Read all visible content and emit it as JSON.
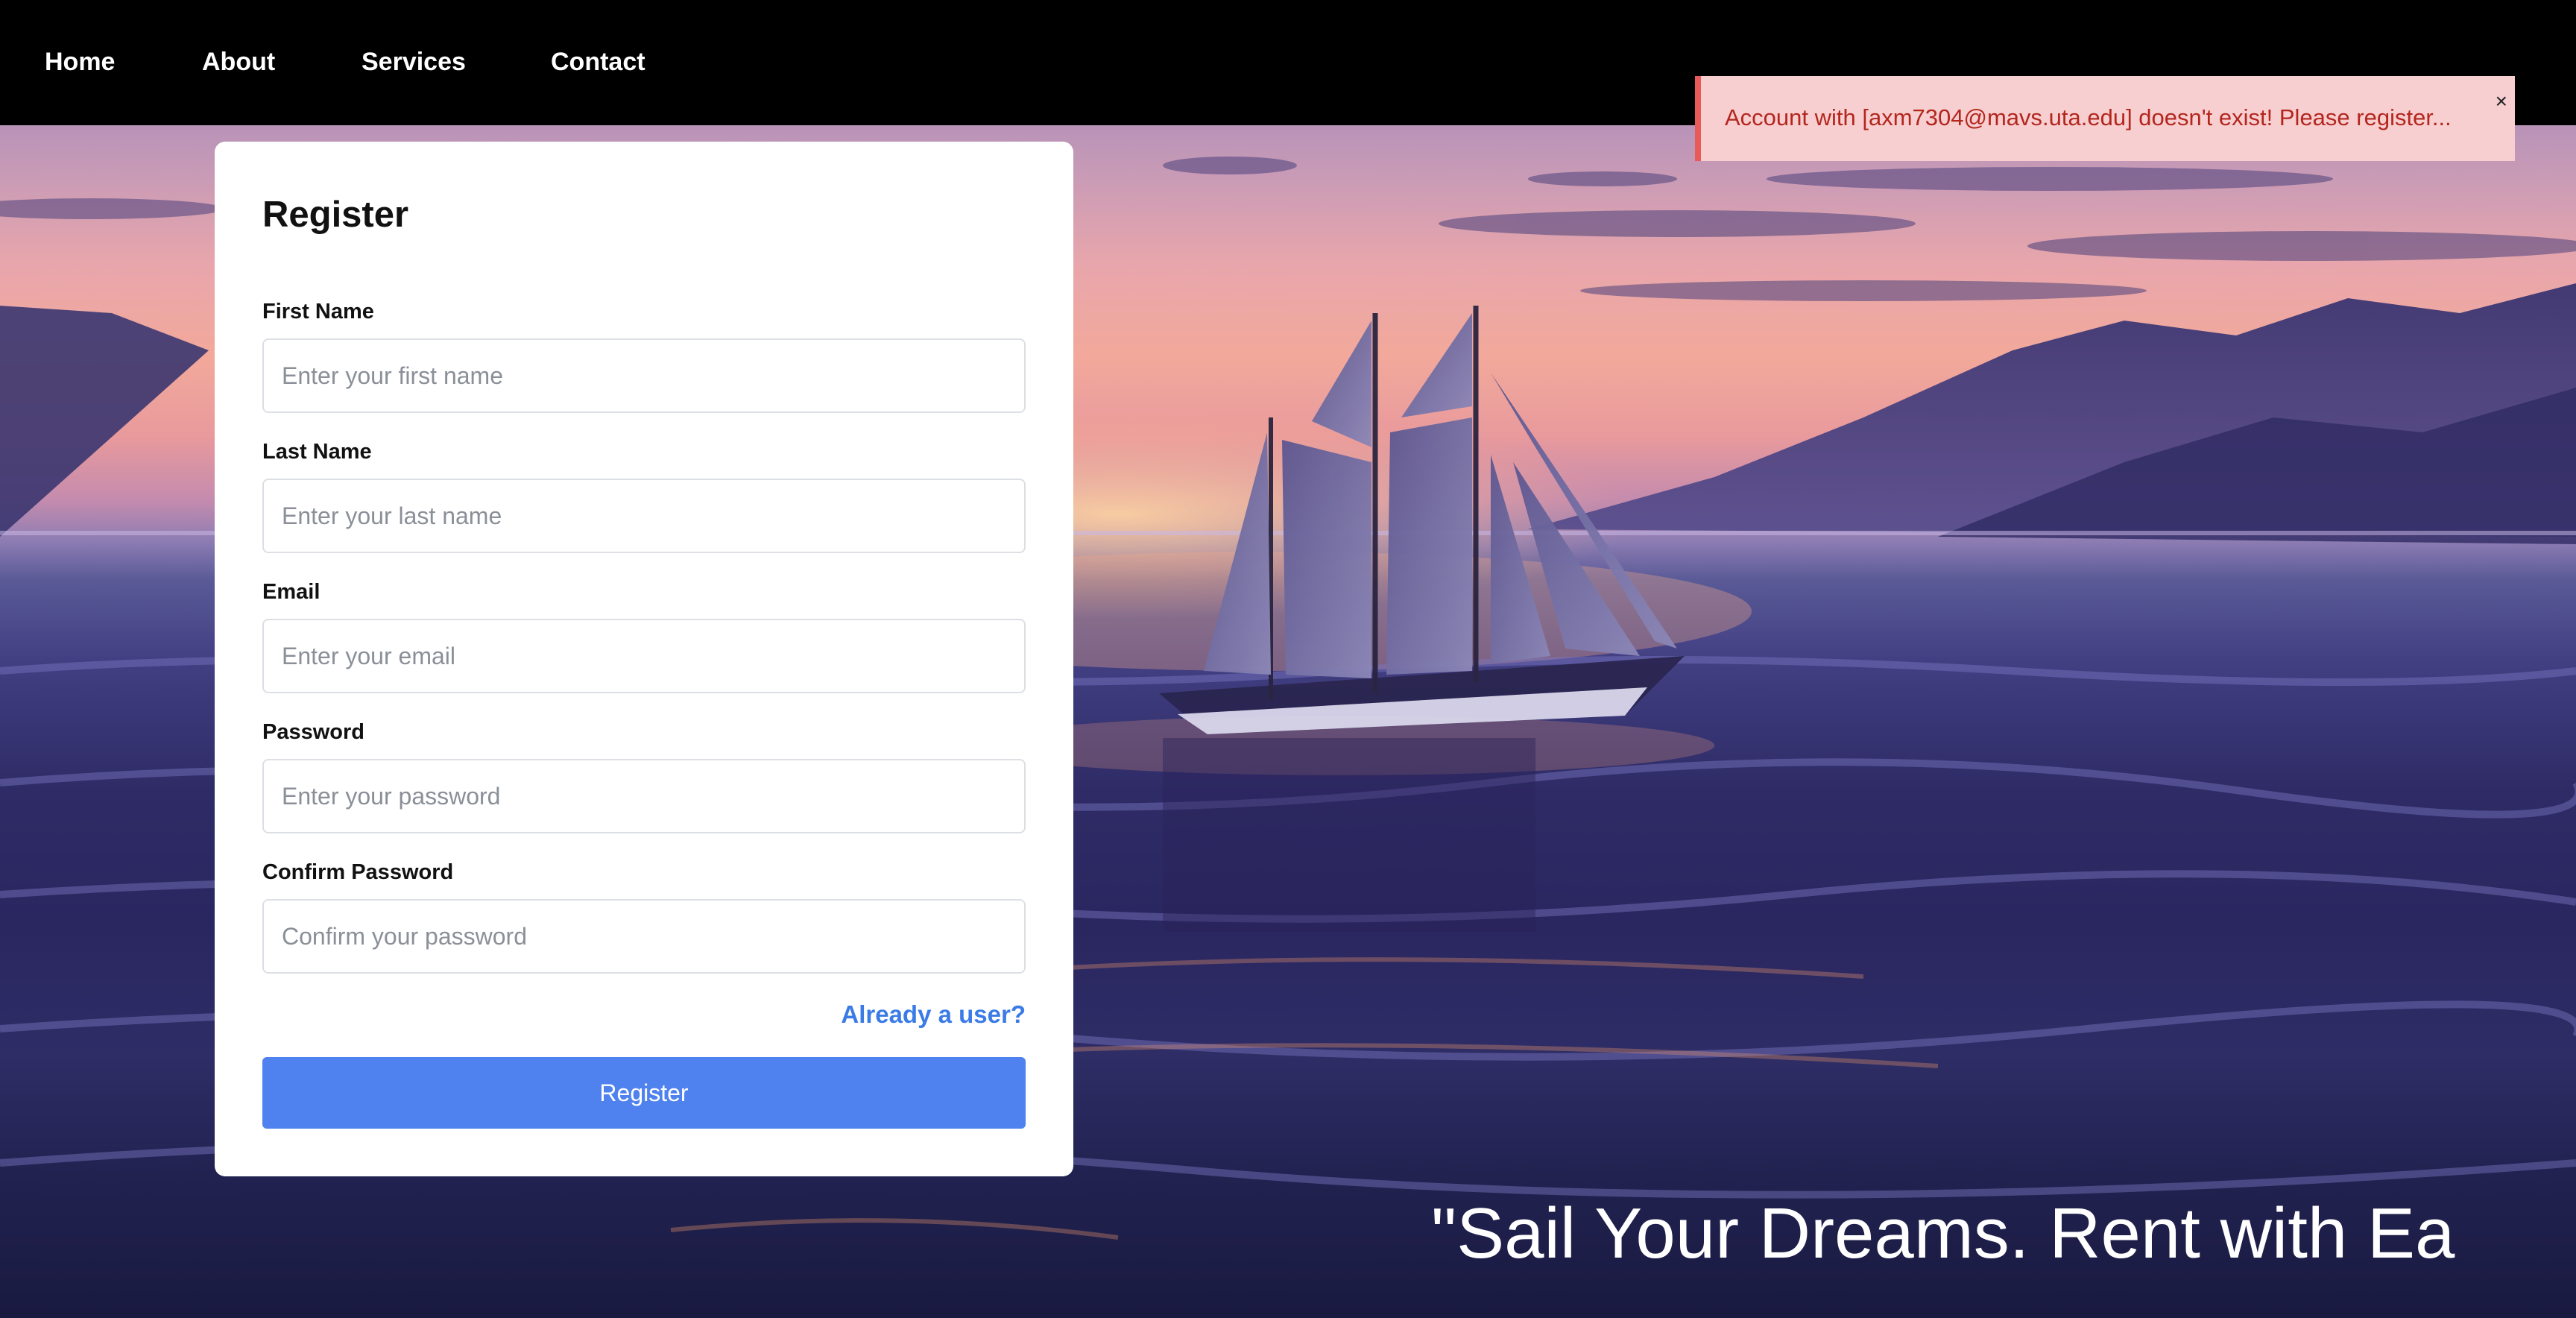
{
  "nav": {
    "items": [
      "Home",
      "About",
      "Services",
      "Contact"
    ]
  },
  "toast": {
    "message": "Account with [axm7304@mavs.uta.edu] doesn't exist! Please register...",
    "close_glyph": "×"
  },
  "register_form": {
    "title": "Register",
    "fields": [
      {
        "label": "First Name",
        "placeholder": "Enter your first name",
        "value": ""
      },
      {
        "label": "Last Name",
        "placeholder": "Enter your last name",
        "value": ""
      },
      {
        "label": "Email",
        "placeholder": "Enter your email",
        "value": ""
      },
      {
        "label": "Password",
        "placeholder": "Enter your password",
        "value": ""
      },
      {
        "label": "Confirm Password",
        "placeholder": "Confirm your password",
        "value": ""
      }
    ],
    "already_user_link": "Already a user?",
    "submit_label": "Register"
  },
  "hero": {
    "tagline": "\"Sail Your Dreams. Rent with Ea"
  },
  "colors": {
    "navbar_bg": "#000000",
    "toast_bg": "#f8cfd0",
    "toast_accent": "#e85a5a",
    "toast_text": "#b3261e",
    "link_blue": "#3b7be6",
    "button_blue": "#4f82ee"
  }
}
